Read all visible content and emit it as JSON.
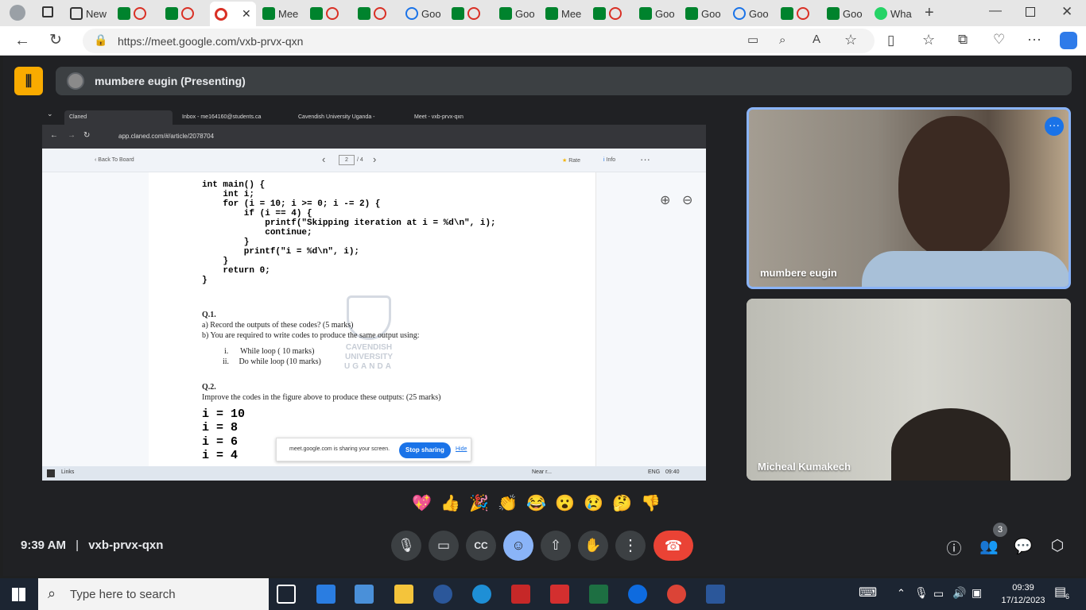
{
  "browser": {
    "tabs": [
      {
        "label": "",
        "icon": "profile-icon"
      },
      {
        "label": "",
        "icon": "tab-actions-icon"
      },
      {
        "label": "New",
        "icon": "new-tab-page-icon"
      },
      {
        "label": "",
        "icon": "meet-icon"
      },
      {
        "label": "",
        "icon": "meet-icon"
      },
      {
        "label": "",
        "icon": "recording-icon"
      },
      {
        "label": "Mee",
        "icon": "meet-icon"
      },
      {
        "label": "",
        "icon": "meet-icon"
      },
      {
        "label": "",
        "icon": "meet-icon"
      },
      {
        "label": "Goo",
        "icon": "loading-icon"
      },
      {
        "label": "",
        "icon": "meet-icon"
      },
      {
        "label": "Goo",
        "icon": "meet-icon"
      },
      {
        "label": "Mee",
        "icon": "meet-icon"
      },
      {
        "label": "",
        "icon": "meet-icon"
      },
      {
        "label": "Goo",
        "icon": "meet-icon"
      },
      {
        "label": "Goo",
        "icon": "meet-icon"
      },
      {
        "label": "Goo",
        "icon": "loading-icon"
      },
      {
        "label": "",
        "icon": "meet-icon"
      },
      {
        "label": "Goo",
        "icon": "meet-icon"
      },
      {
        "label": "Wha",
        "icon": "whatsapp-icon"
      }
    ],
    "url": "https://meet.google.com/vxb-prvx-qxn"
  },
  "meet": {
    "presenter_label": "mumbere eugin (Presenting)",
    "participants": [
      {
        "name": "mumbere eugin"
      },
      {
        "name": "Micheal Kumakech"
      }
    ],
    "time": "9:39 AM",
    "separator": "|",
    "meeting_code": "vxb-prvx-qxn",
    "people_count": "3",
    "reactions": [
      "💖",
      "👍",
      "🎉",
      "👏",
      "😂",
      "😮",
      "😢",
      "🤔",
      "👎"
    ]
  },
  "shared_screen": {
    "tabs": [
      "Claned",
      "Inbox - me164160@students.ca",
      "Cavendish University Uganda -",
      "Meet - vxb-prvx-qxn"
    ],
    "url": "app.claned.com/#/article/2078704",
    "back_label": "‹ Back To Board",
    "page_current": "2",
    "page_total": "/ 4",
    "rate_label": "Rate",
    "info_label": "Info",
    "code_lines": [
      "int main() {",
      "    int i;",
      "    for (i = 10; i >= 0; i -= 2) {",
      "        if (i == 4) {",
      "            printf(\"Skipping iteration at i = %d\\n\", i);",
      "            continue;",
      "        }",
      "        printf(\"i = %d\\n\", i);",
      "    }",
      "    return 0;",
      "}"
    ],
    "q1_title": "Q.1.",
    "q1_a": "a) Record the outputs of these codes? (5 marks)",
    "q1_b": "b) You are required to write codes to produce the same output using:",
    "q1_b_i": "i.      While loop ( 10 marks)",
    "q1_b_ii": "ii.     Do while loop (10 marks)",
    "q2_title": "Q.2.",
    "q2_text": "Improve the codes in the figure above to produce these outputs: (25 marks)",
    "outputs": [
      "i = 10",
      "i = 8",
      "i = 6",
      "i = 4"
    ],
    "watermark_line1": "CAVENDISH",
    "watermark_line2": "UNIVERSITY",
    "watermark_line3": "UGANDA",
    "sharing_text": "meet.google.com is sharing your screen.",
    "stop_sharing": "Stop sharing",
    "hide": "Hide",
    "taskbar_links": "Links",
    "taskbar_weather": "Near r...",
    "taskbar_lang": "ENG",
    "taskbar_time": "09:40"
  },
  "taskbar": {
    "search_placeholder": "Type here to search",
    "time": "09:39",
    "date": "17/12/2023",
    "notifications": "6"
  },
  "colors": {
    "meet_bg": "#202124",
    "accent_blue": "#1a73e8",
    "hangup_red": "#ea4335",
    "active_tile_border": "#8ab4f8"
  }
}
